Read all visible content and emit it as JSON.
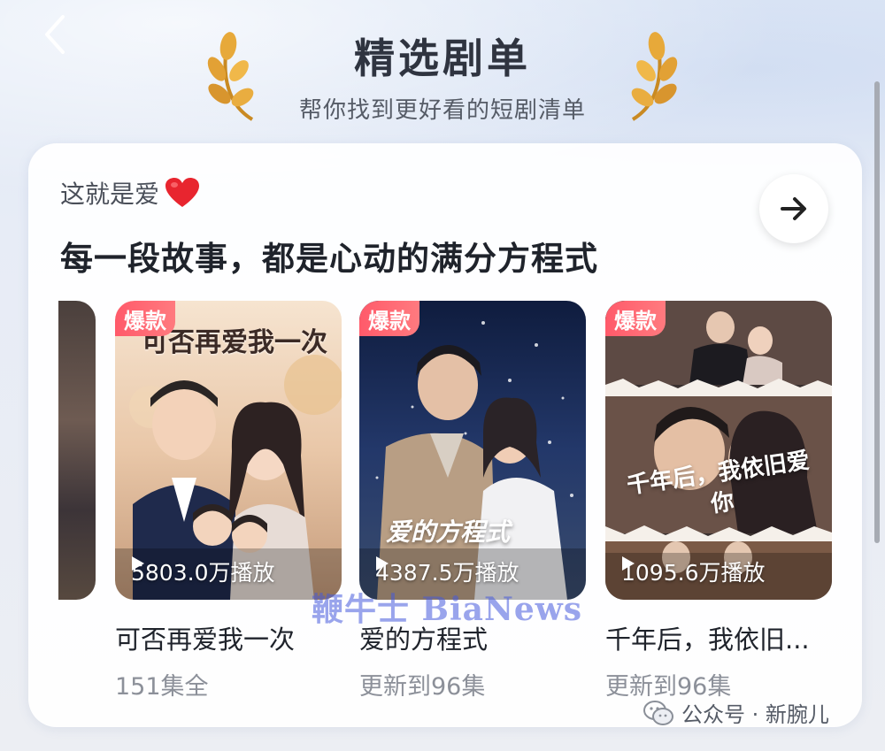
{
  "header": {
    "title": "精选剧单",
    "subtitle": "帮你找到更好看的短剧清单"
  },
  "card": {
    "tag": "这就是爱",
    "heading": "每一段故事，都是心动的满分方程式"
  },
  "dramas": [
    {
      "badge": "爆款",
      "poster_title": "可否再爱我一次",
      "plays": "5803.0万播放",
      "name": "可否再爱我一次",
      "episodes": "151集全"
    },
    {
      "badge": "爆款",
      "poster_title": "爱的方程式",
      "plays": "4387.5万播放",
      "name": "爱的方程式",
      "episodes": "更新到96集"
    },
    {
      "badge": "爆款",
      "poster_title": "千年后，我依旧爱你",
      "plays": "1095.6万播放",
      "name": "千年后，我依旧...",
      "episodes": "更新到96集"
    }
  ],
  "watermark": "鞭牛士 BiaNews",
  "wechat_credit": "公众号 · 新腕儿",
  "colors": {
    "badge": "#ff5a6a",
    "title": "#2f3440",
    "muted": "#8c9099"
  }
}
